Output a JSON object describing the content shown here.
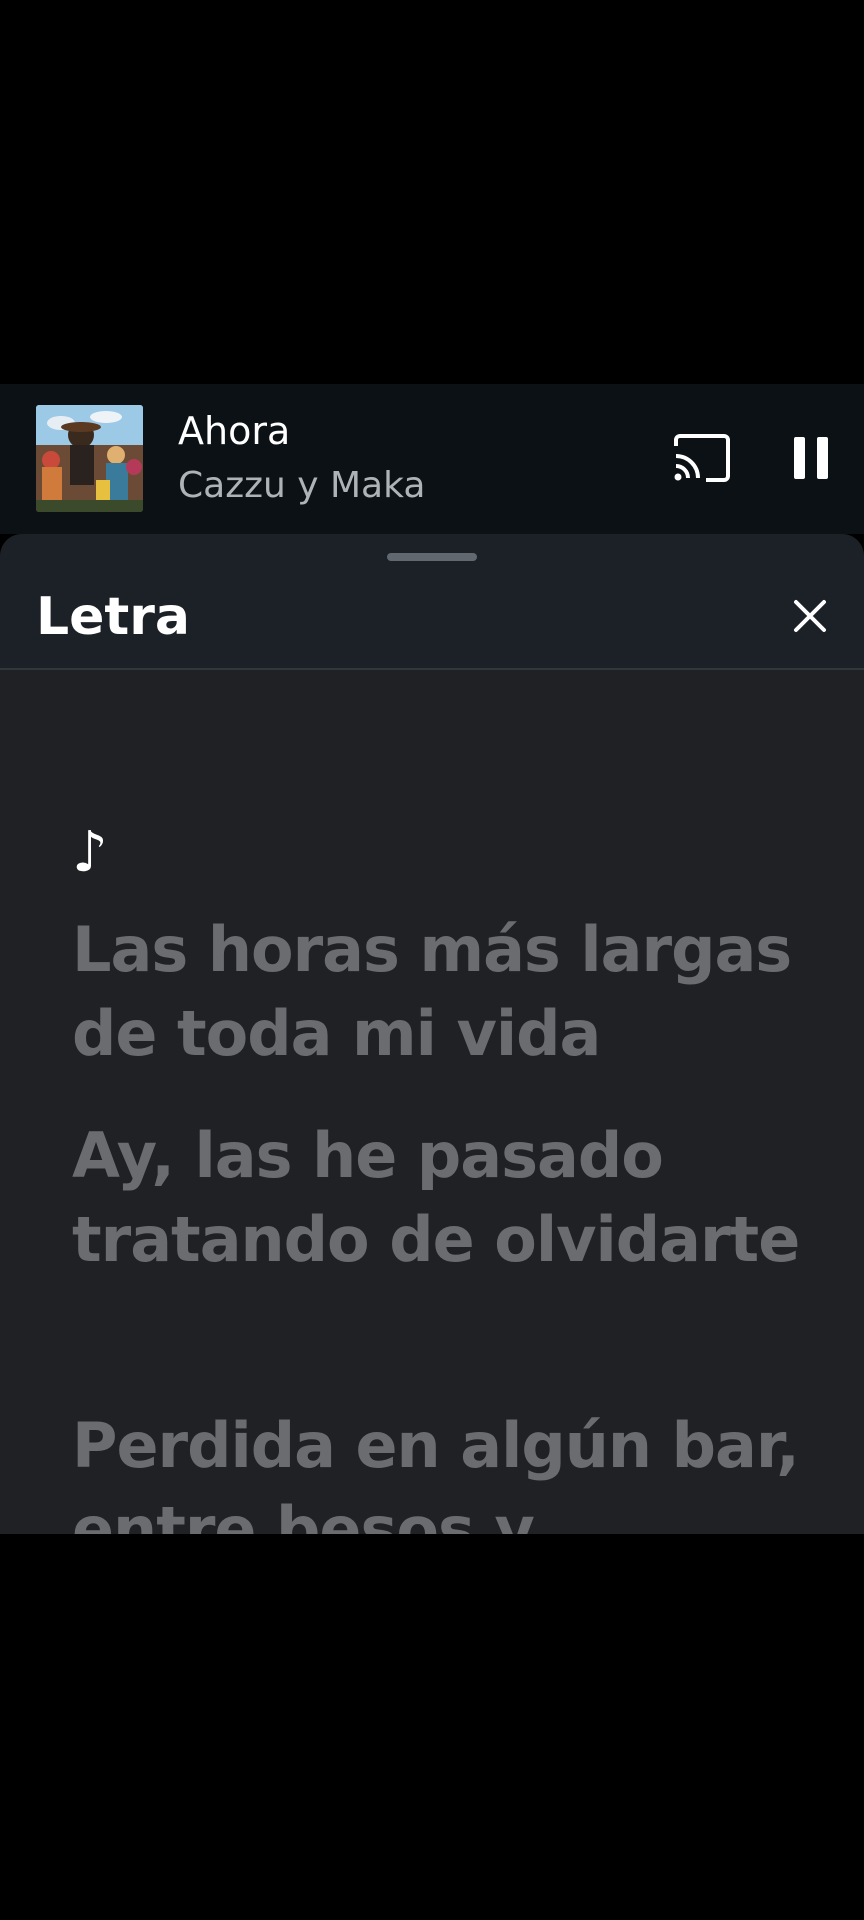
{
  "player": {
    "title": "Ahora",
    "artist": "Cazzu y Maka",
    "album_art_icon": "album-cover",
    "cast_icon": "cast-icon",
    "pause_icon": "pause-icon"
  },
  "lyrics_sheet": {
    "title": "Letra",
    "close_icon": "close-icon",
    "note_symbol": "♪",
    "lines": [
      "Las horas más largas de toda mi vida",
      "Ay, las he pasado tratando de olvidarte",
      "Perdida en algún bar, entre besos y"
    ]
  },
  "colors": {
    "background": "#000000",
    "mini_player_bg": "#0c1116",
    "sheet_bg": "#1f2125",
    "lyric_dim": "#6a6c70",
    "artist_gray": "#aeb3b8"
  }
}
